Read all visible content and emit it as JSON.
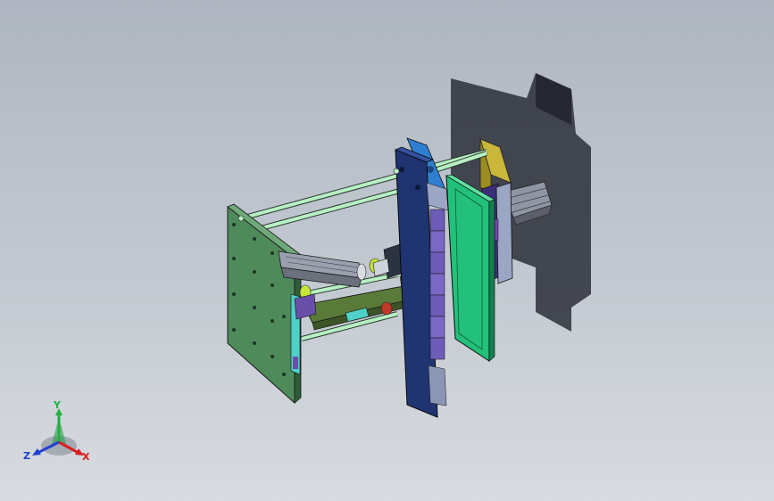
{
  "viewport": {
    "background_top": "#aeb6c1",
    "background_bottom": "#d8dbe0"
  },
  "model": {
    "colors": {
      "left_plate": "#4f8a5a",
      "center_plate": "#1f3470",
      "green_plate": "#22c07a",
      "yellow_plate": "#b9a72a",
      "blue_plate": "#2f7fd0",
      "guide_rods": "#b8f0c4",
      "cylinder": "#8f95a3",
      "slider": "#6a4fa8",
      "accent_red": "#c0392b",
      "shadow": "#2b2f38"
    }
  },
  "triad": {
    "x_label": "X",
    "y_label": "Y",
    "z_label": "Z",
    "x_color": "#d62020",
    "y_color": "#20b040",
    "z_color": "#2040d0"
  }
}
